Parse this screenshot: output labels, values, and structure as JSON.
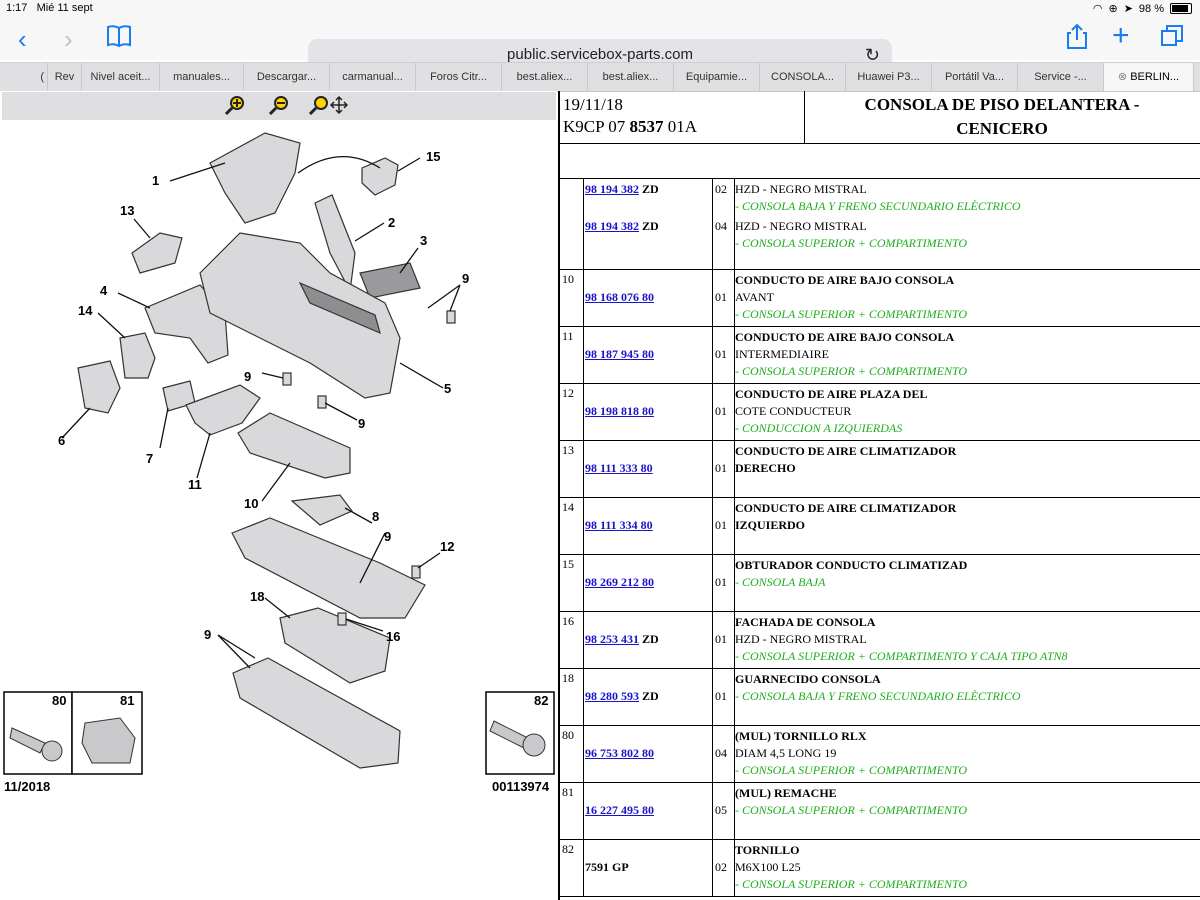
{
  "status": {
    "time": "1:17",
    "date": "Mié 11 sept",
    "battery": "98 %"
  },
  "browser": {
    "url": "public.servicebox-parts.com"
  },
  "tabs": [
    "(",
    "Rev",
    "Nivel aceit...",
    "manuales...",
    "Descargar...",
    "carmanual...",
    "Foros Citr...",
    "best.aliex...",
    "best.aliex...",
    "Equipamie...",
    "CONSOLA...",
    "Huawei P3...",
    "Portátil Va...",
    "Service -...",
    "BERLIN..."
  ],
  "diagram": {
    "labels": [
      "1",
      "2",
      "3",
      "4",
      "5",
      "6",
      "7",
      "8",
      "9",
      "9",
      "9",
      "9",
      "10",
      "11",
      "12",
      "13",
      "14",
      "15",
      "16",
      "18"
    ],
    "inset_labels": [
      "80",
      "81",
      "82"
    ],
    "footer_left": "11/2018",
    "footer_right": "00113974"
  },
  "header": {
    "date": "19/11/18",
    "code_a": "K9CP 07",
    "code_b": "8537",
    "code_c": "01A",
    "title_line1": "CONSOLA DE PISO DELANTERA -",
    "title_line2": "CENICERO"
  },
  "rows": [
    {
      "ref": "",
      "h": 90,
      "lines": [
        {
          "pn": "98 194 382",
          "suffix": "ZD",
          "qty": "02",
          "y": 3
        },
        {
          "text": "HZD - NEGRO MISTRAL",
          "y": 3,
          "style": "plain"
        },
        {
          "text": "- CONSOLA BAJA Y FRENO SECUNDARIO ELÈCTRICO",
          "y": 20,
          "style": "green"
        },
        {
          "pn": "98 194 382",
          "suffix": "ZD",
          "qty": "04",
          "y": 40
        },
        {
          "text": "HZD - NEGRO MISTRAL",
          "y": 40,
          "style": "plain"
        },
        {
          "text": "- CONSOLA SUPERIOR + COMPARTIMENTO",
          "y": 57,
          "style": "green"
        }
      ]
    },
    {
      "ref": "10",
      "h": 56,
      "lines": [
        {
          "text": "CONDUCTO DE AIRE BAJO CONSOLA",
          "y": 3,
          "style": "b"
        },
        {
          "pn": "98 168 076 80",
          "qty": "01",
          "y": 20
        },
        {
          "text": "AVANT",
          "y": 20,
          "style": "plain"
        },
        {
          "text": "- CONSOLA SUPERIOR + COMPARTIMENTO",
          "y": 37,
          "style": "green"
        }
      ]
    },
    {
      "ref": "11",
      "h": 56,
      "lines": [
        {
          "text": "CONDUCTO DE AIRE BAJO CONSOLA",
          "y": 3,
          "style": "b"
        },
        {
          "pn": "98 187 945 80",
          "qty": "01",
          "y": 20
        },
        {
          "text": "INTERMEDIAIRE",
          "y": 20,
          "style": "plain"
        },
        {
          "text": "- CONSOLA SUPERIOR + COMPARTIMENTO",
          "y": 37,
          "style": "green"
        }
      ]
    },
    {
      "ref": "12",
      "h": 56,
      "lines": [
        {
          "text": "CONDUCTO DE AIRE PLAZA DEL",
          "y": 3,
          "style": "b"
        },
        {
          "pn": "98 198 818 80",
          "qty": "01",
          "y": 20
        },
        {
          "text": "COTE CONDUCTEUR",
          "y": 20,
          "style": "plain"
        },
        {
          "text": "- CONDUCCION A IZQUIERDAS",
          "y": 37,
          "style": "green"
        }
      ]
    },
    {
      "ref": "13",
      "h": 56,
      "lines": [
        {
          "text": "CONDUCTO DE AIRE CLIMATIZADOR",
          "y": 3,
          "style": "b"
        },
        {
          "pn": "98 111 333 80",
          "qty": "01",
          "y": 20
        },
        {
          "text": "DERECHO",
          "y": 20,
          "style": "b"
        }
      ]
    },
    {
      "ref": "14",
      "h": 56,
      "lines": [
        {
          "text": "CONDUCTO DE AIRE CLIMATIZADOR",
          "y": 3,
          "style": "b"
        },
        {
          "pn": "98 111 334 80",
          "qty": "01",
          "y": 20
        },
        {
          "text": "IZQUIERDO",
          "y": 20,
          "style": "b"
        }
      ]
    },
    {
      "ref": "15",
      "h": 56,
      "lines": [
        {
          "text": "OBTURADOR CONDUCTO CLIMATIZAD",
          "y": 3,
          "style": "b"
        },
        {
          "pn": "98 269 212 80",
          "qty": "01",
          "y": 20
        },
        {
          "text": "- CONSOLA BAJA",
          "y": 20,
          "style": "green"
        }
      ]
    },
    {
      "ref": "16",
      "h": 56,
      "lines": [
        {
          "text": "FACHADA DE CONSOLA",
          "y": 3,
          "style": "b"
        },
        {
          "pn": "98 253 431",
          "suffix": "ZD",
          "qty": "01",
          "y": 20
        },
        {
          "text": "HZD - NEGRO MISTRAL",
          "y": 20,
          "style": "plain"
        },
        {
          "text": "- CONSOLA SUPERIOR + COMPARTIMENTO Y CAJA TIPO ATN8",
          "y": 37,
          "style": "green"
        }
      ]
    },
    {
      "ref": "18",
      "h": 56,
      "lines": [
        {
          "text": "GUARNECIDO CONSOLA",
          "y": 3,
          "style": "b"
        },
        {
          "pn": "98 280 593",
          "suffix": "ZD",
          "qty": "01",
          "y": 20
        },
        {
          "text": "- CONSOLA BAJA Y FRENO SECUNDARIO ELÈCTRICO",
          "y": 20,
          "style": "green"
        }
      ]
    },
    {
      "ref": "80",
      "h": 56,
      "lines": [
        {
          "text": "(MUL) TORNILLO RLX",
          "y": 3,
          "style": "b"
        },
        {
          "pn": "96 753 802 80",
          "qty": "04",
          "y": 20
        },
        {
          "text": "DIAM 4,5 LONG 19",
          "y": 20,
          "style": "plain"
        },
        {
          "text": "- CONSOLA SUPERIOR + COMPARTIMENTO",
          "y": 37,
          "style": "green"
        }
      ]
    },
    {
      "ref": "81",
      "h": 56,
      "lines": [
        {
          "text": "(MUL) REMACHE",
          "y": 3,
          "style": "b"
        },
        {
          "pn": "16 227 495 80",
          "qty": "05",
          "y": 20
        },
        {
          "text": "- CONSOLA SUPERIOR + COMPARTIMENTO",
          "y": 20,
          "style": "green"
        }
      ]
    },
    {
      "ref": "82",
      "h": 56,
      "lines": [
        {
          "text": "TORNILLO",
          "y": 3,
          "style": "b"
        },
        {
          "pnplain": "7591 GP",
          "qty": "02",
          "y": 20
        },
        {
          "text": "M6X100 L25",
          "y": 20,
          "style": "plain"
        },
        {
          "text": "- CONSOLA SUPERIOR + COMPARTIMENTO",
          "y": 37,
          "style": "green"
        }
      ]
    }
  ]
}
